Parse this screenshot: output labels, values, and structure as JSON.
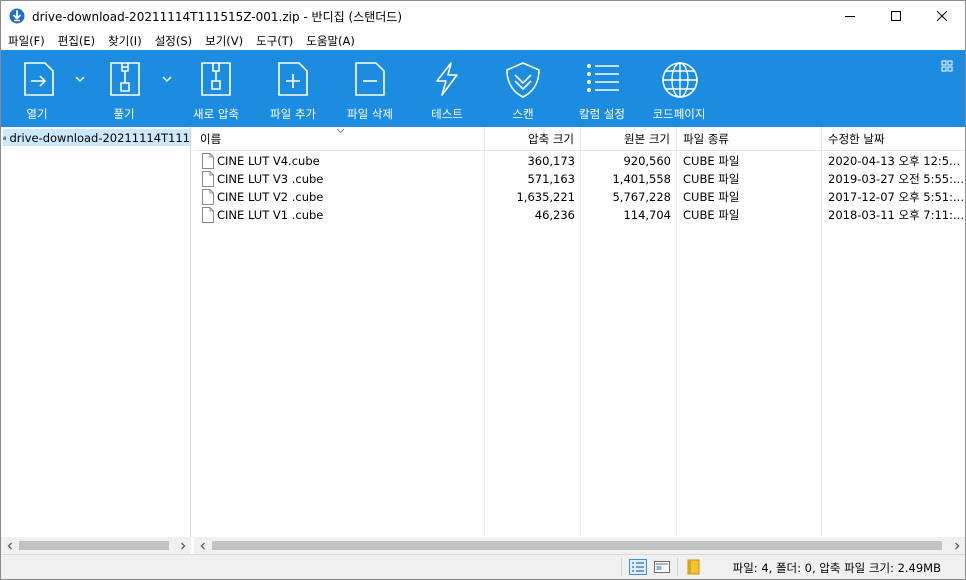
{
  "window": {
    "title": "drive-download-20211114T111515Z-001.zip - 반디집 (스탠더드)",
    "minimize_icon": "minimize-icon",
    "maximize_icon": "maximize-icon",
    "close_icon": "close-icon"
  },
  "menu": [
    {
      "label": "파일(F)"
    },
    {
      "label": "편집(E)"
    },
    {
      "label": "찾기(I)"
    },
    {
      "label": "설정(S)"
    },
    {
      "label": "보기(V)"
    },
    {
      "label": "도구(T)"
    },
    {
      "label": "도움말(A)"
    }
  ],
  "toolbar": {
    "open": "열기",
    "extract": "풀기",
    "new_archive": "새로 압축",
    "add_file": "파일 추가",
    "delete_file": "파일 삭제",
    "test": "테스트",
    "scan": "스캔",
    "column_settings": "칼럼 설정",
    "codepage": "코드페이지",
    "accent_color": "#1c8ce0"
  },
  "tree": {
    "root_label": "drive-download-20211114T111"
  },
  "list": {
    "columns": {
      "name": "이름",
      "compressed_size": "압축 크기",
      "original_size": "원본 크기",
      "file_type": "파일 종류",
      "modified": "수정한 날짜"
    },
    "rows": [
      {
        "name": "CINE LUT V4.cube",
        "compressed": "360,173",
        "original": "920,560",
        "type": "CUBE 파일",
        "modified": "2020-04-13 오후 12:5..."
      },
      {
        "name": "CINE LUT V3 .cube",
        "compressed": "571,163",
        "original": "1,401,558",
        "type": "CUBE 파일",
        "modified": "2019-03-27 오전 5:55:..."
      },
      {
        "name": "CINE LUT V2 .cube",
        "compressed": "1,635,221",
        "original": "5,767,228",
        "type": "CUBE 파일",
        "modified": "2017-12-07 오후 5:51:..."
      },
      {
        "name": "CINE LUT V1 .cube",
        "compressed": "46,236",
        "original": "114,704",
        "type": "CUBE 파일",
        "modified": "2018-03-11 오후 7:11:..."
      }
    ]
  },
  "status": {
    "text": "파일: 4, 폴더: 0, 압축 파일 크기: 2.49MB"
  }
}
